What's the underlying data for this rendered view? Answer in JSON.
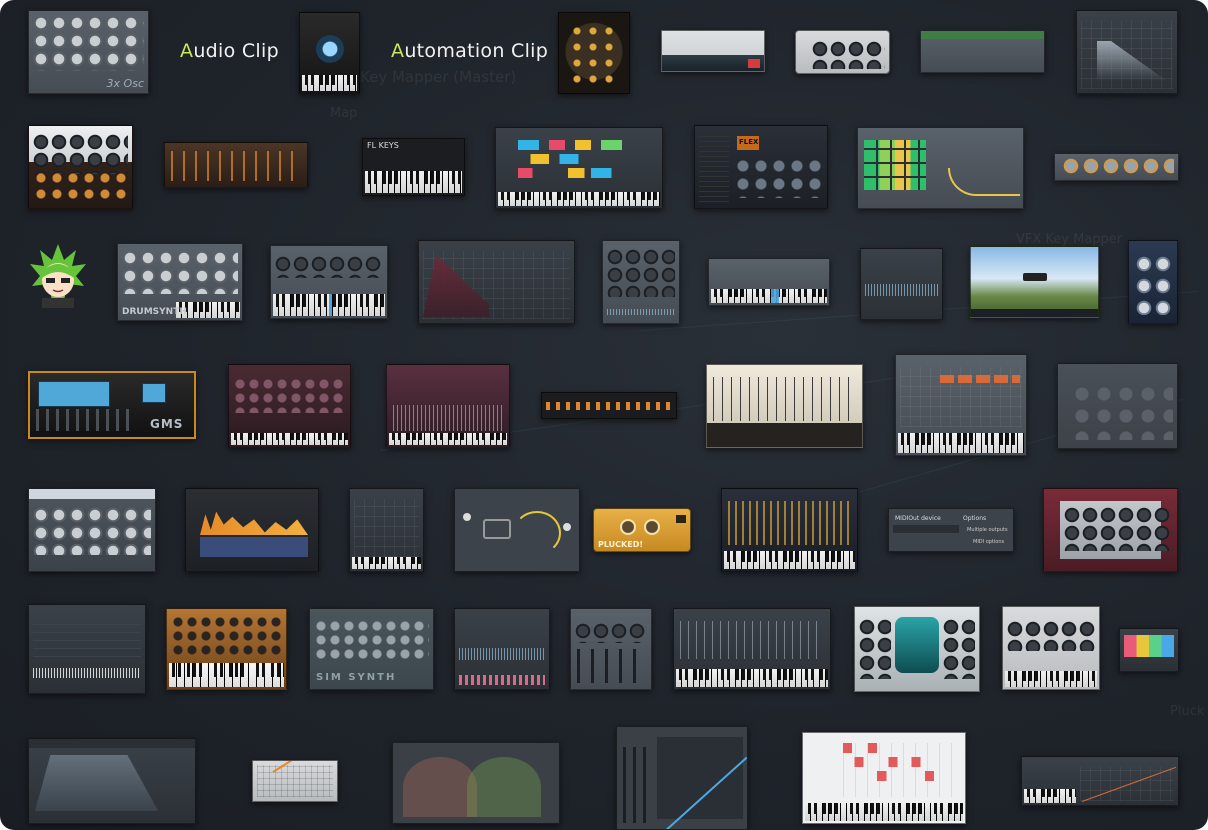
{
  "labels": {
    "audio_clip": {
      "first": "A",
      "rest": "udio Clip"
    },
    "automation_clip": {
      "first": "A",
      "rest": "utomation Clip"
    }
  },
  "tiles": {
    "osc": "3x Osc",
    "gms": "GMS",
    "drumsynth": "DRUMSYNTH",
    "fl_keys": "FL KEYS",
    "flex": "FLEX",
    "sim_synth": "SIM SYNTH",
    "plucked": "PLUCKED!",
    "map": "Map",
    "key_mapper": "Key Mapper (Master)",
    "vfx_key_mapper": "VFX Key Mapper",
    "midi_out_title": "MIDIOut device",
    "multiple_outputs": "Multiple outputs",
    "midi_options": "MIDI options",
    "options": "Options",
    "pluck": "Pluck"
  },
  "colors": {
    "accent_green": "#c8e85a",
    "background": "#1f242b"
  }
}
